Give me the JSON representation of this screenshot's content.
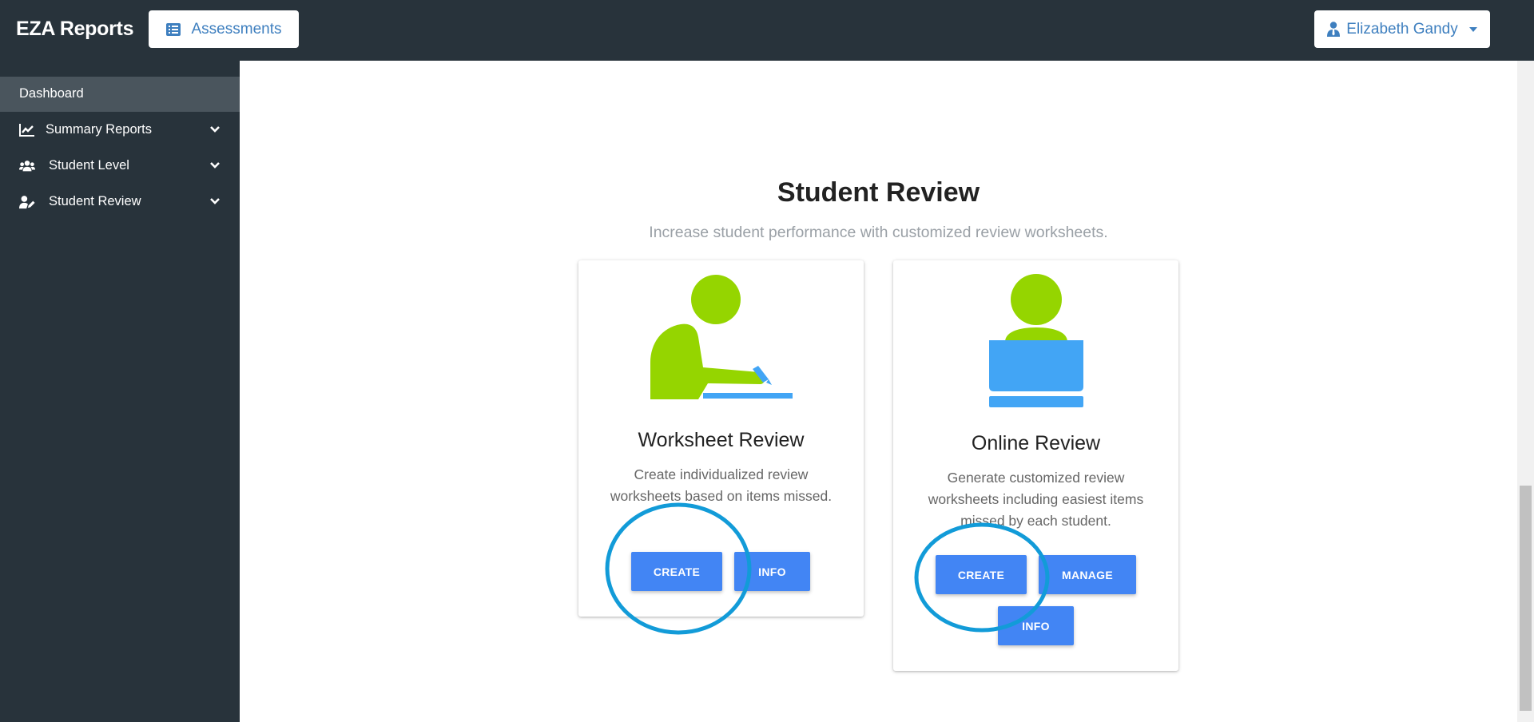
{
  "header": {
    "brand": "EZA Reports",
    "assessments_label": "Assessments",
    "user_name": "Elizabeth Gandy"
  },
  "sidebar": {
    "items": [
      {
        "label": "Dashboard",
        "icon": "none"
      },
      {
        "label": "Summary Reports",
        "icon": "line-chart-icon"
      },
      {
        "label": "Student Level",
        "icon": "users-icon"
      },
      {
        "label": "Student Review",
        "icon": "user-edit-icon"
      }
    ]
  },
  "main": {
    "title": "Student Review",
    "subtitle": "Increase student performance with customized review worksheets.",
    "cards": [
      {
        "title": "Worksheet Review",
        "description": "Create individualized review worksheets based on items missed.",
        "buttons": [
          "CREATE",
          "INFO"
        ]
      },
      {
        "title": "Online Review",
        "description": "Generate customized review worksheets including easiest items missed by each student.",
        "buttons": [
          "CREATE",
          "MANAGE",
          "INFO"
        ]
      }
    ]
  },
  "colors": {
    "topbar": "#28333b",
    "accent": "#4285f4",
    "figure_green": "#95d500",
    "figure_blue": "#42a5f5",
    "annotation": "#129bd8"
  }
}
